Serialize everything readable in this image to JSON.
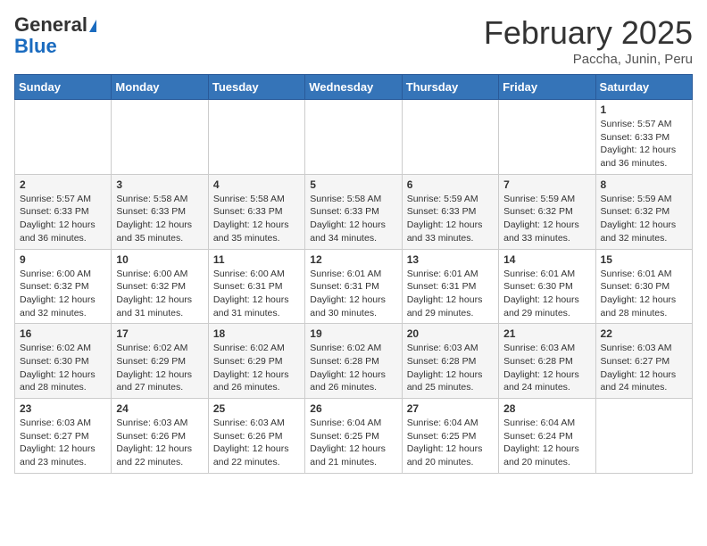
{
  "logo": {
    "line1": "General",
    "line2": "Blue"
  },
  "header": {
    "month": "February 2025",
    "location": "Paccha, Junin, Peru"
  },
  "weekdays": [
    "Sunday",
    "Monday",
    "Tuesday",
    "Wednesday",
    "Thursday",
    "Friday",
    "Saturday"
  ],
  "weeks": [
    [
      {
        "day": "",
        "info": ""
      },
      {
        "day": "",
        "info": ""
      },
      {
        "day": "",
        "info": ""
      },
      {
        "day": "",
        "info": ""
      },
      {
        "day": "",
        "info": ""
      },
      {
        "day": "",
        "info": ""
      },
      {
        "day": "1",
        "info": "Sunrise: 5:57 AM\nSunset: 6:33 PM\nDaylight: 12 hours\nand 36 minutes."
      }
    ],
    [
      {
        "day": "2",
        "info": "Sunrise: 5:57 AM\nSunset: 6:33 PM\nDaylight: 12 hours\nand 36 minutes."
      },
      {
        "day": "3",
        "info": "Sunrise: 5:58 AM\nSunset: 6:33 PM\nDaylight: 12 hours\nand 35 minutes."
      },
      {
        "day": "4",
        "info": "Sunrise: 5:58 AM\nSunset: 6:33 PM\nDaylight: 12 hours\nand 35 minutes."
      },
      {
        "day": "5",
        "info": "Sunrise: 5:58 AM\nSunset: 6:33 PM\nDaylight: 12 hours\nand 34 minutes."
      },
      {
        "day": "6",
        "info": "Sunrise: 5:59 AM\nSunset: 6:33 PM\nDaylight: 12 hours\nand 33 minutes."
      },
      {
        "day": "7",
        "info": "Sunrise: 5:59 AM\nSunset: 6:32 PM\nDaylight: 12 hours\nand 33 minutes."
      },
      {
        "day": "8",
        "info": "Sunrise: 5:59 AM\nSunset: 6:32 PM\nDaylight: 12 hours\nand 32 minutes."
      }
    ],
    [
      {
        "day": "9",
        "info": "Sunrise: 6:00 AM\nSunset: 6:32 PM\nDaylight: 12 hours\nand 32 minutes."
      },
      {
        "day": "10",
        "info": "Sunrise: 6:00 AM\nSunset: 6:32 PM\nDaylight: 12 hours\nand 31 minutes."
      },
      {
        "day": "11",
        "info": "Sunrise: 6:00 AM\nSunset: 6:31 PM\nDaylight: 12 hours\nand 31 minutes."
      },
      {
        "day": "12",
        "info": "Sunrise: 6:01 AM\nSunset: 6:31 PM\nDaylight: 12 hours\nand 30 minutes."
      },
      {
        "day": "13",
        "info": "Sunrise: 6:01 AM\nSunset: 6:31 PM\nDaylight: 12 hours\nand 29 minutes."
      },
      {
        "day": "14",
        "info": "Sunrise: 6:01 AM\nSunset: 6:30 PM\nDaylight: 12 hours\nand 29 minutes."
      },
      {
        "day": "15",
        "info": "Sunrise: 6:01 AM\nSunset: 6:30 PM\nDaylight: 12 hours\nand 28 minutes."
      }
    ],
    [
      {
        "day": "16",
        "info": "Sunrise: 6:02 AM\nSunset: 6:30 PM\nDaylight: 12 hours\nand 28 minutes."
      },
      {
        "day": "17",
        "info": "Sunrise: 6:02 AM\nSunset: 6:29 PM\nDaylight: 12 hours\nand 27 minutes."
      },
      {
        "day": "18",
        "info": "Sunrise: 6:02 AM\nSunset: 6:29 PM\nDaylight: 12 hours\nand 26 minutes."
      },
      {
        "day": "19",
        "info": "Sunrise: 6:02 AM\nSunset: 6:28 PM\nDaylight: 12 hours\nand 26 minutes."
      },
      {
        "day": "20",
        "info": "Sunrise: 6:03 AM\nSunset: 6:28 PM\nDaylight: 12 hours\nand 25 minutes."
      },
      {
        "day": "21",
        "info": "Sunrise: 6:03 AM\nSunset: 6:28 PM\nDaylight: 12 hours\nand 24 minutes."
      },
      {
        "day": "22",
        "info": "Sunrise: 6:03 AM\nSunset: 6:27 PM\nDaylight: 12 hours\nand 24 minutes."
      }
    ],
    [
      {
        "day": "23",
        "info": "Sunrise: 6:03 AM\nSunset: 6:27 PM\nDaylight: 12 hours\nand 23 minutes."
      },
      {
        "day": "24",
        "info": "Sunrise: 6:03 AM\nSunset: 6:26 PM\nDaylight: 12 hours\nand 22 minutes."
      },
      {
        "day": "25",
        "info": "Sunrise: 6:03 AM\nSunset: 6:26 PM\nDaylight: 12 hours\nand 22 minutes."
      },
      {
        "day": "26",
        "info": "Sunrise: 6:04 AM\nSunset: 6:25 PM\nDaylight: 12 hours\nand 21 minutes."
      },
      {
        "day": "27",
        "info": "Sunrise: 6:04 AM\nSunset: 6:25 PM\nDaylight: 12 hours\nand 20 minutes."
      },
      {
        "day": "28",
        "info": "Sunrise: 6:04 AM\nSunset: 6:24 PM\nDaylight: 12 hours\nand 20 minutes."
      },
      {
        "day": "",
        "info": ""
      }
    ]
  ]
}
